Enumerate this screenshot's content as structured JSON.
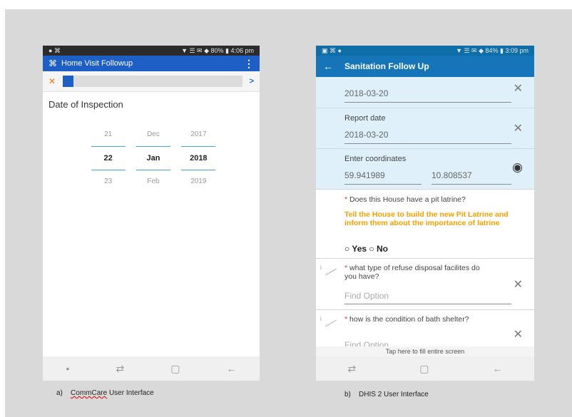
{
  "phone_a": {
    "status": {
      "left": "● ⌘",
      "right": "▼ ☰ ✉ ◆ 80% ▮ 4:06 pm"
    },
    "appbar": {
      "icon": "⌘",
      "title": "Home Visit Followup",
      "menu": "⋮"
    },
    "progress": {
      "close": "✕",
      "next": ">",
      "fraction": 0.06
    },
    "question": "Date of Inspection",
    "picker": {
      "rows": [
        {
          "day": "21",
          "month": "Dec",
          "year": "2017"
        },
        {
          "day": "22",
          "month": "Jan",
          "year": "2018"
        },
        {
          "day": "23",
          "month": "Feb",
          "year": "2019"
        }
      ]
    },
    "nav": {
      "dot": "•",
      "recent": "⇄",
      "home": "▢",
      "back": "←"
    }
  },
  "phone_b": {
    "status": {
      "left": "▣ ⌘ ●",
      "right": "▼ ☰ ✉ ◆ 84% ▮ 3:09 pm"
    },
    "appbar": {
      "back": "←",
      "title": "Sanitation Follow Up"
    },
    "fields": {
      "date1_value": "2018-03-20",
      "report_label": "Report date",
      "report_value": "2018-03-20",
      "coord_label": "Enter coordinates",
      "lat": "59.941989",
      "lon": "10.808537",
      "q1": "Does this House have a pit latrine?",
      "q1_star": "*",
      "q1_warning": "Tell the House to build the new Pit Latrine and inform them about the importance of latrine",
      "q1_radios": "○ Yes ○ No",
      "q2": "what type of  refuse disposal facilites do you have?",
      "q2_star": "*",
      "q2_placeholder": "Find Option",
      "q3": "how is the condition of bath shelter?",
      "q3_star": "*",
      "q3_placeholder": "Find Option",
      "i_mark": "i"
    },
    "clear": "✕",
    "eye": "◉",
    "footer_hint": "Tap here to fill entire screen",
    "nav": {
      "recent": "⇄",
      "home": "▢",
      "back": "←"
    }
  },
  "captions": {
    "a_label": "a)",
    "a_word1": "CommCare",
    "a_rest": "User Interface",
    "b_label": "b)",
    "b_text": "DHIS 2 User Interface"
  }
}
